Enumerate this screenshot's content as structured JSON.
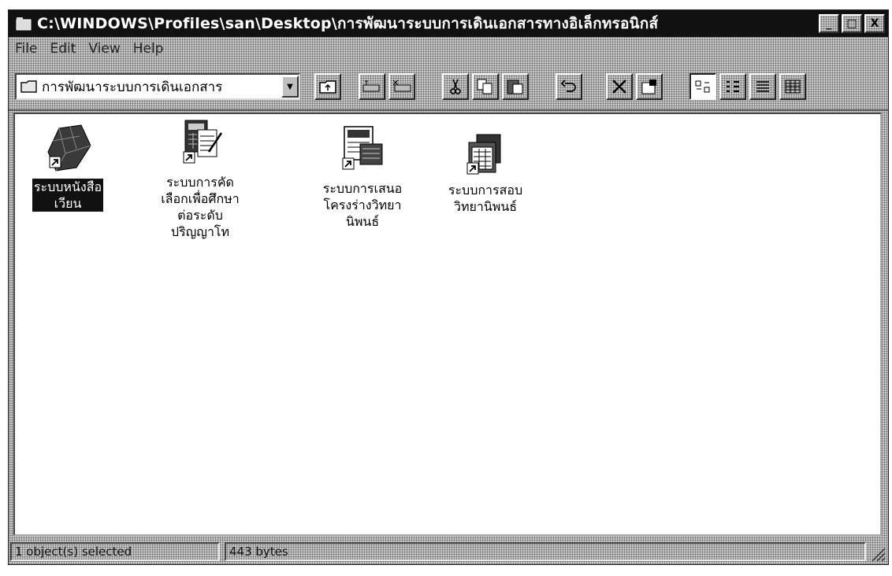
{
  "window": {
    "title": "C:\\WINDOWS\\Profiles\\san\\Desktop\\การพัฒนาระบบการเดินเอกสารทางอิเล็กทรอนิกส์",
    "minimize_glyph": "_",
    "maximize_glyph": "□",
    "close_glyph": "X"
  },
  "menu": {
    "file": "File",
    "edit": "Edit",
    "view": "View",
    "help": "Help"
  },
  "toolbar": {
    "address_value": "การพัฒนาระบบการเดินเอกสาร",
    "buttons": [
      "up-one-level",
      "map-network-drive",
      "disconnect-network-drive",
      "cut",
      "copy",
      "paste",
      "undo",
      "delete",
      "properties",
      "large-icons",
      "small-icons",
      "list",
      "details"
    ]
  },
  "icons": [
    {
      "label": "ระบบหนังสือ\nเวียน",
      "icon": "books-shortcut-icon",
      "selected": true
    },
    {
      "label": "ระบบการคัด\nเลือกเพื่อศึกษา\nต่อระดับ\nปริญญาโท",
      "icon": "calculator-document-shortcut-icon",
      "selected": false
    },
    {
      "label": "ระบบการเสนอ\nโครงร่างวิทยา\nนิพนธ์",
      "icon": "form-document-shortcut-icon",
      "selected": false
    },
    {
      "label": "ระบบการสอบ\nวิทยานิพนธ์",
      "icon": "app-window-shortcut-icon",
      "selected": false
    }
  ],
  "status": {
    "selection": "1 object(s) selected",
    "size": "443 bytes"
  }
}
